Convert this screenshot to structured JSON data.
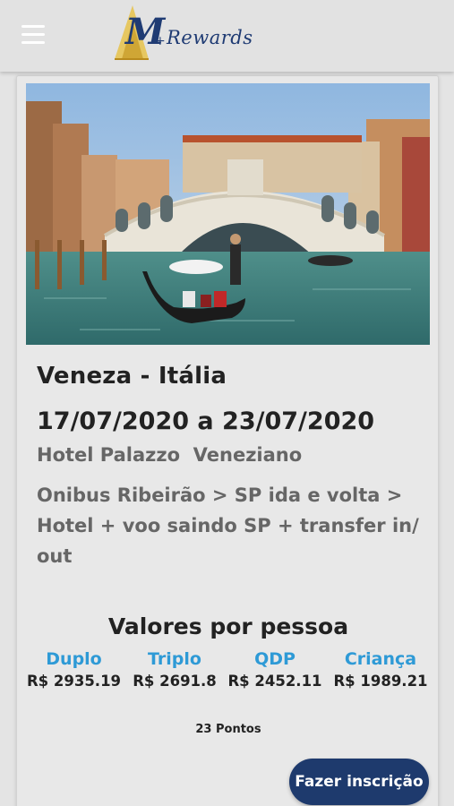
{
  "header": {
    "logo_main": "M",
    "logo_plus": "+",
    "logo_text": "Rewards"
  },
  "trip": {
    "title": "Veneza - Itália",
    "dates": "17/07/2020 a 23/07/2020",
    "hotel": "Hotel Palazzo  Veneziano",
    "description": "Onibus Ribeirão > SP ida e volta > Hotel + voo saindo SP + transfer in/ out"
  },
  "prices": {
    "title": "Valores por pessoa",
    "items": [
      {
        "label": "Duplo",
        "value": "R$ 2935.19"
      },
      {
        "label": "Triplo",
        "value": "R$ 2691.8"
      },
      {
        "label": "QDP",
        "value": "R$ 2452.11"
      },
      {
        "label": "Criança",
        "value": "R$ 1989.21"
      }
    ]
  },
  "points": "23 Pontos",
  "signup_label": "Fazer inscrição",
  "colors": {
    "accent": "#2e9ad6",
    "button": "#1e3a6d",
    "logo": "#1f3b73"
  }
}
